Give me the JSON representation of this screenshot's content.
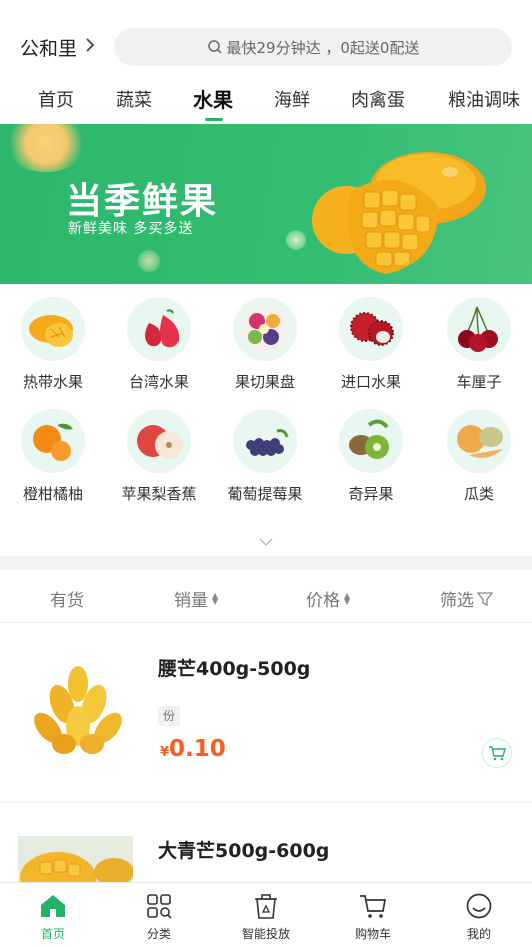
{
  "header": {
    "location": "公和里",
    "search_text": "最快29分钟达 ，0起送0配送"
  },
  "tabs": [
    "首页",
    "蔬菜",
    "水果",
    "海鲜",
    "肉禽蛋",
    "粮油调味"
  ],
  "active_tab": "水果",
  "banner": {
    "title": "当季鲜果",
    "subtitle": "新鲜美味  多买多送"
  },
  "categories": [
    {
      "label": "热带水果",
      "icon": "mango-icon"
    },
    {
      "label": "台湾水果",
      "icon": "wax-apple-icon"
    },
    {
      "label": "果切果盘",
      "icon": "fruit-platter-icon"
    },
    {
      "label": "进口水果",
      "icon": "rambutan-icon"
    },
    {
      "label": "车厘子",
      "icon": "cherry-icon"
    },
    {
      "label": "橙柑橘柚",
      "icon": "orange-icon"
    },
    {
      "label": "苹果梨香蕉",
      "icon": "apple-icon"
    },
    {
      "label": "葡萄提莓果",
      "icon": "grape-icon"
    },
    {
      "label": "奇异果",
      "icon": "kiwi-icon"
    },
    {
      "label": "瓜类",
      "icon": "melon-icon"
    }
  ],
  "sort": {
    "in_stock": "有货",
    "sales": "销量",
    "price": "价格",
    "filter": "筛选"
  },
  "products": [
    {
      "name": "腰芒400g-500g",
      "unit": "份",
      "currency": "¥",
      "price": "0.10"
    },
    {
      "name": "大青芒500g-600g"
    }
  ],
  "bottom_nav": [
    {
      "label": "首页",
      "icon": "home-icon",
      "active": true
    },
    {
      "label": "分类",
      "icon": "category-icon",
      "active": false
    },
    {
      "label": "智能投放",
      "icon": "smart-bin-icon",
      "active": false
    },
    {
      "label": "购物车",
      "icon": "cart-icon",
      "active": false
    },
    {
      "label": "我的",
      "icon": "profile-icon",
      "active": false
    }
  ],
  "colors": {
    "accent": "#24b366",
    "price": "#ff5a1f",
    "banner": "#2cb66c"
  }
}
